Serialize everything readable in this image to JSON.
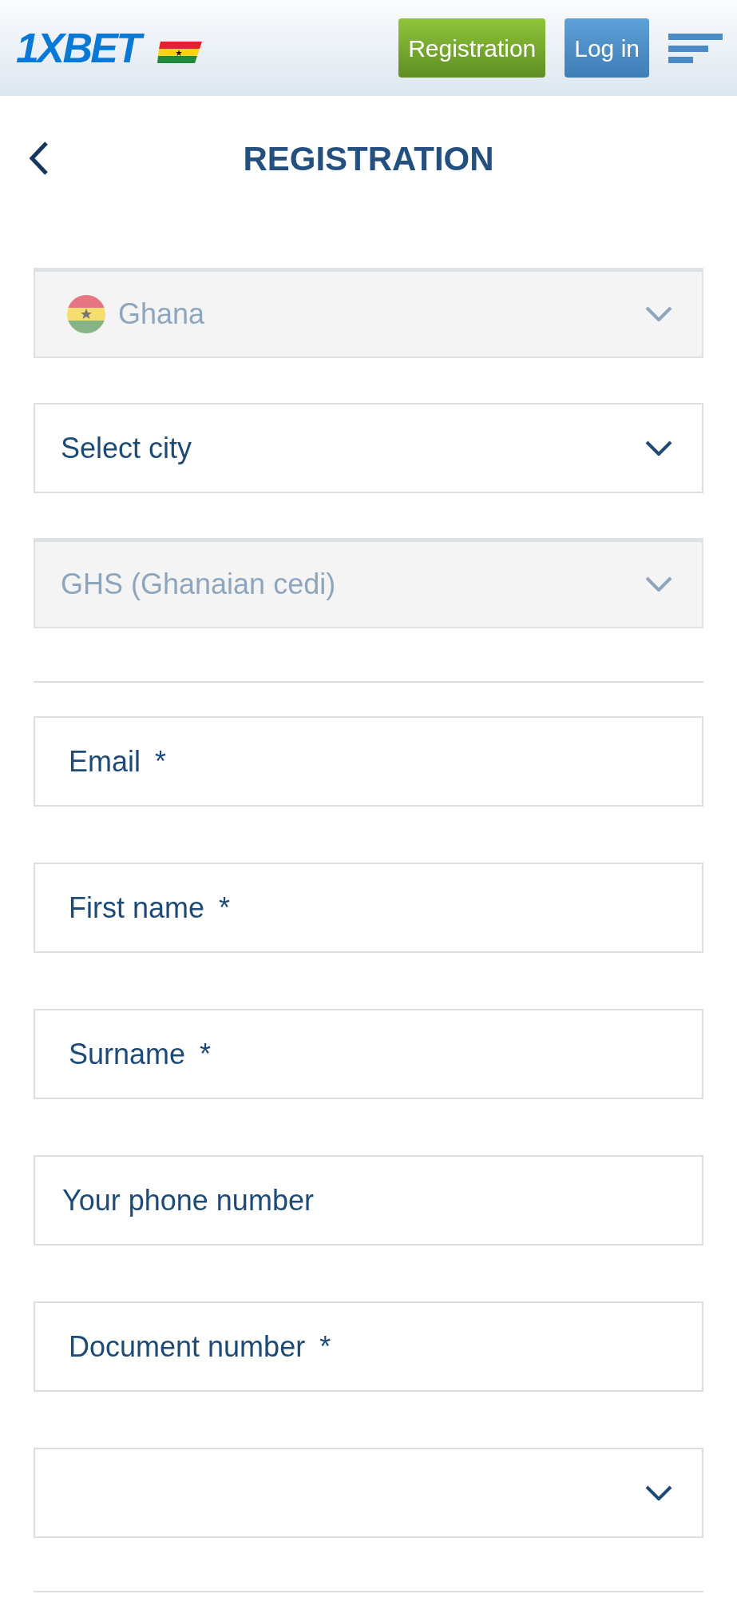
{
  "header": {
    "logo": "1XBET",
    "buttons": [
      {
        "kind": "register",
        "label": "Registration"
      },
      {
        "kind": "login",
        "label": "Log in"
      }
    ]
  },
  "page": {
    "title": "REGISTRATION"
  },
  "selects": [
    {
      "kind": "country",
      "value": "Ghana",
      "disabled": true
    },
    {
      "kind": "plain",
      "value": "Select city",
      "disabled": false
    },
    {
      "kind": "plain",
      "value": "GHS (Ghanaian cedi)",
      "disabled": true
    }
  ],
  "fields": [
    {
      "kind": "input",
      "placeholder": "Email",
      "marker": "*"
    },
    {
      "kind": "input",
      "placeholder": "First name",
      "marker": "*"
    },
    {
      "kind": "input",
      "placeholder": "Surname",
      "marker": "*"
    },
    {
      "kind": "input",
      "placeholder": "Your phone number"
    },
    {
      "kind": "input",
      "placeholder": "Document number",
      "marker": "*"
    },
    {
      "kind": "select"
    }
  ]
}
